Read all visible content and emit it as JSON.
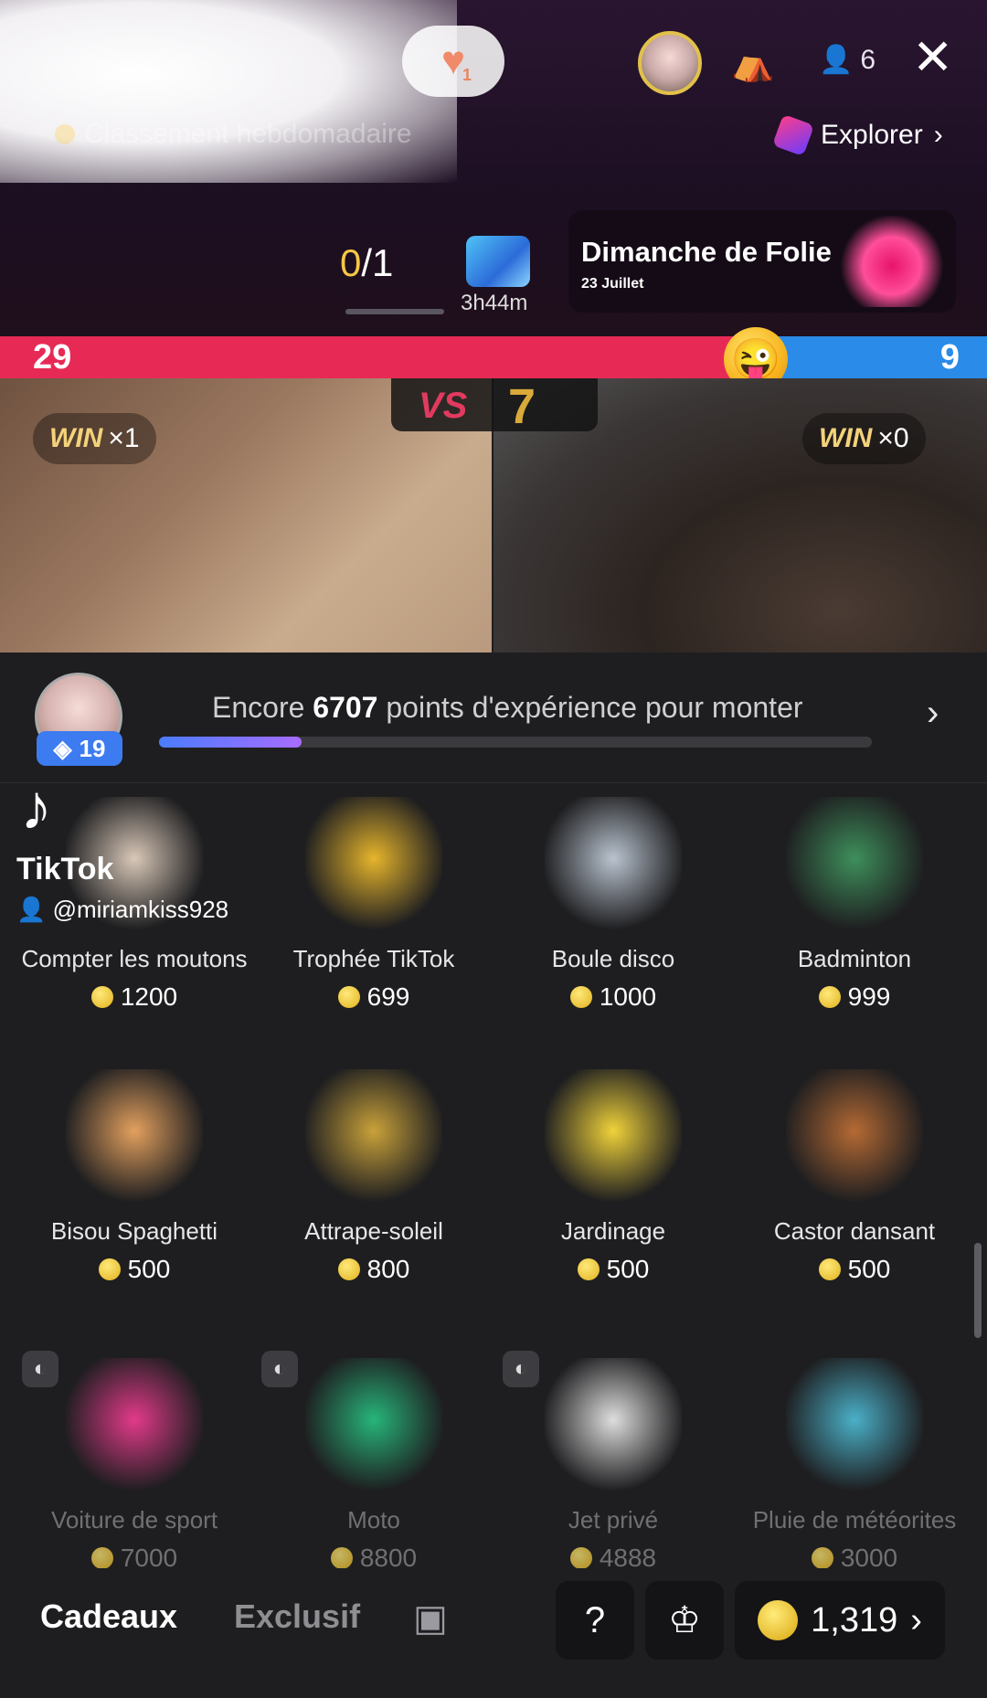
{
  "live": {
    "likes": "1",
    "viewers": "6",
    "weekly_ranking": "Classement hebdomadaire",
    "explore": "Explorer",
    "goal_progress": "0",
    "goal_total": "/1",
    "timer": "3h44m",
    "event_title": "Dimanche de Folie",
    "event_date": "23 Juillet",
    "icons": {
      "close": "close-icon",
      "seat": "seat-icon",
      "viewer": "person-icon"
    }
  },
  "battle": {
    "left_score": "29",
    "right_score": "9",
    "left_fraction": 0.777,
    "vs": "VS",
    "round": "7",
    "left_wins_label": "WIN",
    "left_wins": "×1",
    "right_wins_label": "WIN",
    "right_wins": "×0"
  },
  "level": {
    "badge": "19",
    "xp_prefix": "Encore ",
    "xp_points": "6707",
    "xp_suffix": " points d'expérience pour monter",
    "xp_progress": 0.2
  },
  "watermark": {
    "brand": "TikTok",
    "user": "@miriamkiss928"
  },
  "gifts": [
    {
      "name": "Compter les moutons",
      "price": "1200",
      "color": "#d9c8b8"
    },
    {
      "name": "Trophée TikTok",
      "price": "699",
      "color": "#e6b52c"
    },
    {
      "name": "Boule disco",
      "price": "1000",
      "color": "#b9c3cf"
    },
    {
      "name": "Badminton",
      "price": "999",
      "color": "#3e8f5b"
    },
    {
      "name": "Bisou Spaghetti",
      "price": "500",
      "color": "#e3a05e"
    },
    {
      "name": "Attrape-soleil",
      "price": "800",
      "color": "#c9a23a"
    },
    {
      "name": "Jardinage",
      "price": "500",
      "color": "#f0d23a"
    },
    {
      "name": "Castor dansant",
      "price": "500",
      "color": "#b56a34"
    },
    {
      "name": "Voiture de sport",
      "price": "7000",
      "color": "#e23a8a"
    },
    {
      "name": "Moto",
      "price": "8800",
      "color": "#27b57a"
    },
    {
      "name": "Jet privé",
      "price": "4888",
      "color": "#dedede"
    },
    {
      "name": "Pluie de météorites",
      "price": "3000",
      "color": "#4ab0c8"
    }
  ],
  "bottom": {
    "tab_gifts": "Cadeaux",
    "tab_exclusive": "Exclusif",
    "balance": "1,319"
  }
}
